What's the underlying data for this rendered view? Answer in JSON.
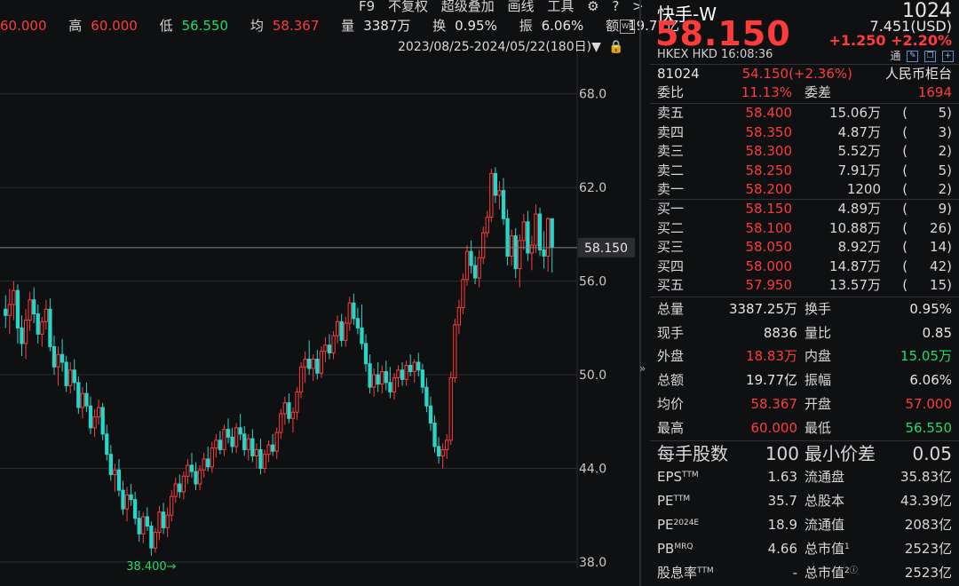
{
  "stats": {
    "open_value": "60.000",
    "high_label": "高",
    "high_value": "60.000",
    "low_label": "低",
    "low_value": "56.550",
    "avg_label": "均",
    "avg_value": "58.367",
    "vol_label": "量",
    "vol_value": "3387万",
    "turn_label": "换",
    "turn_value": "0.95%",
    "amp_label": "振",
    "amp_value": "6.06%",
    "amt_label": "额",
    "amt_value": "19.77亿"
  },
  "menu": {
    "f9": "F9",
    "adjust": "不复权",
    "overlay": "超级叠加",
    "draw": "画线",
    "tools": "工具",
    "gear_icon": "gear-icon",
    "help_icon": "help-icon",
    "more_icon": "chevron-right-icon"
  },
  "date_range": "2023/08/25-2024/05/22(180日)",
  "chart_data": {
    "type": "candlestick",
    "y_ticks": [
      "68.0",
      "62.0",
      "56.0",
      "50.0",
      "44.0",
      "38.0"
    ],
    "ylim": [
      37.6,
      70.6
    ],
    "last_price_tag": "58.150",
    "low_marker": "38.400→",
    "colors": {
      "up": "#ff3b3b",
      "down": "#27d6c9",
      "grid": "#2a2c31",
      "price_line": "#888888"
    },
    "candles": [
      {
        "o": 54.2,
        "h": 55.1,
        "l": 53.0,
        "c": 53.8
      },
      {
        "o": 53.8,
        "h": 55.5,
        "l": 52.6,
        "c": 54.5
      },
      {
        "o": 54.5,
        "h": 56.0,
        "l": 53.5,
        "c": 55.4
      },
      {
        "o": 55.4,
        "h": 55.8,
        "l": 52.0,
        "c": 53.0
      },
      {
        "o": 53.0,
        "h": 53.8,
        "l": 51.2,
        "c": 52.0
      },
      {
        "o": 52.0,
        "h": 54.2,
        "l": 51.0,
        "c": 53.5
      },
      {
        "o": 53.5,
        "h": 55.3,
        "l": 52.8,
        "c": 54.8
      },
      {
        "o": 54.8,
        "h": 55.6,
        "l": 53.3,
        "c": 53.9
      },
      {
        "o": 53.9,
        "h": 54.5,
        "l": 52.0,
        "c": 52.6
      },
      {
        "o": 52.6,
        "h": 53.7,
        "l": 51.8,
        "c": 53.4
      },
      {
        "o": 53.4,
        "h": 54.8,
        "l": 52.9,
        "c": 54.2
      },
      {
        "o": 54.2,
        "h": 54.9,
        "l": 51.5,
        "c": 51.8
      },
      {
        "o": 51.8,
        "h": 52.5,
        "l": 50.0,
        "c": 50.5
      },
      {
        "o": 50.5,
        "h": 51.8,
        "l": 49.3,
        "c": 51.3
      },
      {
        "o": 51.3,
        "h": 52.3,
        "l": 50.2,
        "c": 50.8
      },
      {
        "o": 50.8,
        "h": 51.2,
        "l": 48.9,
        "c": 49.3
      },
      {
        "o": 49.3,
        "h": 50.8,
        "l": 48.8,
        "c": 50.3
      },
      {
        "o": 50.3,
        "h": 51.0,
        "l": 49.0,
        "c": 49.5
      },
      {
        "o": 49.5,
        "h": 49.9,
        "l": 47.5,
        "c": 47.9
      },
      {
        "o": 47.9,
        "h": 49.2,
        "l": 47.2,
        "c": 48.8
      },
      {
        "o": 48.8,
        "h": 49.5,
        "l": 47.6,
        "c": 48.0
      },
      {
        "o": 48.0,
        "h": 48.6,
        "l": 46.2,
        "c": 46.6
      },
      {
        "o": 46.6,
        "h": 47.8,
        "l": 46.0,
        "c": 47.3
      },
      {
        "o": 47.3,
        "h": 48.4,
        "l": 46.8,
        "c": 47.9
      },
      {
        "o": 47.9,
        "h": 48.2,
        "l": 45.8,
        "c": 46.2
      },
      {
        "o": 46.2,
        "h": 46.8,
        "l": 44.5,
        "c": 44.9
      },
      {
        "o": 44.9,
        "h": 45.5,
        "l": 43.2,
        "c": 43.6
      },
      {
        "o": 43.6,
        "h": 44.3,
        "l": 42.5,
        "c": 43.9
      },
      {
        "o": 43.9,
        "h": 44.6,
        "l": 42.2,
        "c": 42.6
      },
      {
        "o": 42.6,
        "h": 43.2,
        "l": 41.0,
        "c": 41.4
      },
      {
        "o": 41.4,
        "h": 42.8,
        "l": 40.6,
        "c": 42.3
      },
      {
        "o": 42.3,
        "h": 43.0,
        "l": 41.6,
        "c": 42.0
      },
      {
        "o": 42.0,
        "h": 42.5,
        "l": 40.4,
        "c": 40.8
      },
      {
        "o": 40.8,
        "h": 41.3,
        "l": 39.3,
        "c": 39.8
      },
      {
        "o": 39.8,
        "h": 41.2,
        "l": 39.2,
        "c": 40.9
      },
      {
        "o": 40.9,
        "h": 41.5,
        "l": 40.0,
        "c": 40.3
      },
      {
        "o": 40.3,
        "h": 40.6,
        "l": 38.4,
        "c": 38.9
      },
      {
        "o": 38.9,
        "h": 40.2,
        "l": 38.6,
        "c": 39.9
      },
      {
        "o": 39.9,
        "h": 41.6,
        "l": 39.4,
        "c": 41.2
      },
      {
        "o": 41.2,
        "h": 41.8,
        "l": 39.8,
        "c": 40.2
      },
      {
        "o": 40.2,
        "h": 41.5,
        "l": 39.6,
        "c": 41.0
      },
      {
        "o": 41.0,
        "h": 42.6,
        "l": 40.6,
        "c": 42.2
      },
      {
        "o": 42.2,
        "h": 43.4,
        "l": 41.8,
        "c": 43.0
      },
      {
        "o": 43.0,
        "h": 43.6,
        "l": 42.1,
        "c": 42.5
      },
      {
        "o": 42.5,
        "h": 43.8,
        "l": 42.0,
        "c": 43.5
      },
      {
        "o": 43.5,
        "h": 44.6,
        "l": 43.0,
        "c": 44.2
      },
      {
        "o": 44.2,
        "h": 45.0,
        "l": 43.4,
        "c": 43.8
      },
      {
        "o": 43.8,
        "h": 44.4,
        "l": 42.6,
        "c": 43.0
      },
      {
        "o": 43.0,
        "h": 44.2,
        "l": 42.6,
        "c": 43.9
      },
      {
        "o": 43.9,
        "h": 45.0,
        "l": 43.4,
        "c": 44.6
      },
      {
        "o": 44.6,
        "h": 45.4,
        "l": 43.8,
        "c": 44.1
      },
      {
        "o": 44.1,
        "h": 45.7,
        "l": 43.7,
        "c": 45.3
      },
      {
        "o": 45.3,
        "h": 46.2,
        "l": 44.7,
        "c": 45.8
      },
      {
        "o": 45.8,
        "h": 46.4,
        "l": 44.9,
        "c": 45.2
      },
      {
        "o": 45.2,
        "h": 46.8,
        "l": 44.8,
        "c": 46.5
      },
      {
        "o": 46.5,
        "h": 47.2,
        "l": 45.6,
        "c": 46.0
      },
      {
        "o": 46.0,
        "h": 46.6,
        "l": 45.0,
        "c": 45.4
      },
      {
        "o": 45.4,
        "h": 46.9,
        "l": 45.0,
        "c": 46.6
      },
      {
        "o": 46.6,
        "h": 47.5,
        "l": 45.8,
        "c": 46.2
      },
      {
        "o": 46.2,
        "h": 46.7,
        "l": 44.8,
        "c": 45.2
      },
      {
        "o": 45.2,
        "h": 46.2,
        "l": 44.5,
        "c": 45.9
      },
      {
        "o": 45.9,
        "h": 46.5,
        "l": 44.4,
        "c": 44.8
      },
      {
        "o": 44.8,
        "h": 45.6,
        "l": 44.0,
        "c": 45.2
      },
      {
        "o": 45.2,
        "h": 45.9,
        "l": 43.6,
        "c": 44.0
      },
      {
        "o": 44.0,
        "h": 45.2,
        "l": 43.7,
        "c": 44.9
      },
      {
        "o": 44.9,
        "h": 45.8,
        "l": 44.4,
        "c": 45.5
      },
      {
        "o": 45.5,
        "h": 46.2,
        "l": 44.8,
        "c": 45.1
      },
      {
        "o": 45.1,
        "h": 46.6,
        "l": 44.6,
        "c": 46.3
      },
      {
        "o": 46.3,
        "h": 47.8,
        "l": 45.9,
        "c": 47.5
      },
      {
        "o": 47.5,
        "h": 48.6,
        "l": 46.8,
        "c": 48.2
      },
      {
        "o": 48.2,
        "h": 48.8,
        "l": 46.9,
        "c": 47.2
      },
      {
        "o": 47.2,
        "h": 47.9,
        "l": 46.3,
        "c": 47.6
      },
      {
        "o": 47.6,
        "h": 49.2,
        "l": 47.1,
        "c": 48.9
      },
      {
        "o": 48.9,
        "h": 50.8,
        "l": 48.5,
        "c": 50.5
      },
      {
        "o": 50.5,
        "h": 51.5,
        "l": 49.5,
        "c": 51.0
      },
      {
        "o": 51.0,
        "h": 52.2,
        "l": 50.0,
        "c": 50.4
      },
      {
        "o": 50.4,
        "h": 51.3,
        "l": 49.6,
        "c": 51.0
      },
      {
        "o": 51.0,
        "h": 51.6,
        "l": 49.7,
        "c": 50.1
      },
      {
        "o": 50.1,
        "h": 51.8,
        "l": 49.8,
        "c": 51.5
      },
      {
        "o": 51.5,
        "h": 52.4,
        "l": 50.8,
        "c": 51.9
      },
      {
        "o": 51.9,
        "h": 52.6,
        "l": 51.0,
        "c": 51.4
      },
      {
        "o": 51.4,
        "h": 52.8,
        "l": 51.0,
        "c": 52.5
      },
      {
        "o": 52.5,
        "h": 53.8,
        "l": 52.0,
        "c": 53.4
      },
      {
        "o": 53.4,
        "h": 53.9,
        "l": 51.8,
        "c": 52.2
      },
      {
        "o": 52.2,
        "h": 53.7,
        "l": 51.8,
        "c": 53.3
      },
      {
        "o": 53.3,
        "h": 55.0,
        "l": 52.8,
        "c": 54.6
      },
      {
        "o": 54.6,
        "h": 55.2,
        "l": 53.2,
        "c": 53.6
      },
      {
        "o": 53.6,
        "h": 54.3,
        "l": 52.6,
        "c": 53.0
      },
      {
        "o": 53.0,
        "h": 54.5,
        "l": 51.6,
        "c": 52.0
      },
      {
        "o": 52.0,
        "h": 52.6,
        "l": 50.2,
        "c": 50.7
      },
      {
        "o": 50.7,
        "h": 51.3,
        "l": 48.8,
        "c": 49.2
      },
      {
        "o": 49.2,
        "h": 50.4,
        "l": 48.6,
        "c": 50.0
      },
      {
        "o": 50.0,
        "h": 50.8,
        "l": 48.9,
        "c": 49.4
      },
      {
        "o": 49.4,
        "h": 50.6,
        "l": 48.8,
        "c": 50.2
      },
      {
        "o": 50.2,
        "h": 50.9,
        "l": 49.0,
        "c": 49.5
      },
      {
        "o": 49.5,
        "h": 50.5,
        "l": 48.5,
        "c": 48.9
      },
      {
        "o": 48.9,
        "h": 50.1,
        "l": 48.4,
        "c": 49.8
      },
      {
        "o": 49.8,
        "h": 50.6,
        "l": 49.2,
        "c": 50.3
      },
      {
        "o": 50.3,
        "h": 50.8,
        "l": 49.3,
        "c": 49.7
      },
      {
        "o": 49.7,
        "h": 50.9,
        "l": 49.3,
        "c": 50.6
      },
      {
        "o": 50.6,
        "h": 51.3,
        "l": 49.9,
        "c": 50.2
      },
      {
        "o": 50.2,
        "h": 51.0,
        "l": 49.5,
        "c": 50.8
      },
      {
        "o": 50.8,
        "h": 51.4,
        "l": 49.9,
        "c": 50.3
      },
      {
        "o": 50.3,
        "h": 50.7,
        "l": 48.8,
        "c": 49.2
      },
      {
        "o": 49.2,
        "h": 49.8,
        "l": 47.6,
        "c": 48.0
      },
      {
        "o": 48.0,
        "h": 48.6,
        "l": 46.4,
        "c": 46.9
      },
      {
        "o": 46.9,
        "h": 47.4,
        "l": 45.0,
        "c": 45.4
      },
      {
        "o": 45.4,
        "h": 46.0,
        "l": 44.3,
        "c": 44.8
      },
      {
        "o": 44.8,
        "h": 45.6,
        "l": 44.0,
        "c": 45.2
      },
      {
        "o": 45.2,
        "h": 46.2,
        "l": 44.6,
        "c": 45.8
      },
      {
        "o": 45.8,
        "h": 50.2,
        "l": 45.5,
        "c": 49.8
      },
      {
        "o": 49.8,
        "h": 53.6,
        "l": 49.5,
        "c": 53.2
      },
      {
        "o": 53.2,
        "h": 54.8,
        "l": 52.6,
        "c": 54.3
      },
      {
        "o": 54.3,
        "h": 56.5,
        "l": 53.9,
        "c": 56.1
      },
      {
        "o": 56.1,
        "h": 58.3,
        "l": 55.7,
        "c": 57.9
      },
      {
        "o": 57.9,
        "h": 58.6,
        "l": 56.5,
        "c": 57.0
      },
      {
        "o": 57.0,
        "h": 57.6,
        "l": 55.8,
        "c": 56.2
      },
      {
        "o": 56.2,
        "h": 58.0,
        "l": 55.6,
        "c": 57.5
      },
      {
        "o": 57.5,
        "h": 59.5,
        "l": 57.1,
        "c": 59.1
      },
      {
        "o": 59.1,
        "h": 60.5,
        "l": 58.8,
        "c": 60.1
      },
      {
        "o": 60.1,
        "h": 63.2,
        "l": 59.8,
        "c": 62.9
      },
      {
        "o": 62.9,
        "h": 63.3,
        "l": 61.0,
        "c": 61.5
      },
      {
        "o": 61.5,
        "h": 62.4,
        "l": 60.6,
        "c": 61.8
      },
      {
        "o": 61.8,
        "h": 62.6,
        "l": 59.6,
        "c": 60.0
      },
      {
        "o": 60.0,
        "h": 60.6,
        "l": 57.0,
        "c": 57.6
      },
      {
        "o": 57.6,
        "h": 59.3,
        "l": 57.0,
        "c": 58.9
      },
      {
        "o": 58.9,
        "h": 59.4,
        "l": 56.2,
        "c": 56.8
      },
      {
        "o": 56.8,
        "h": 59.0,
        "l": 55.6,
        "c": 58.6
      },
      {
        "o": 58.6,
        "h": 60.3,
        "l": 58.0,
        "c": 59.8
      },
      {
        "o": 59.8,
        "h": 60.5,
        "l": 57.3,
        "c": 57.8
      },
      {
        "o": 57.8,
        "h": 58.9,
        "l": 56.7,
        "c": 58.3
      },
      {
        "o": 58.3,
        "h": 60.9,
        "l": 57.8,
        "c": 60.3
      },
      {
        "o": 60.3,
        "h": 60.7,
        "l": 57.6,
        "c": 58.0
      },
      {
        "o": 58.0,
        "h": 59.2,
        "l": 56.8,
        "c": 57.6
      },
      {
        "o": 57.6,
        "h": 60.1,
        "l": 56.6,
        "c": 60.0
      },
      {
        "o": 60.0,
        "h": 60.0,
        "l": 56.55,
        "c": 58.15
      }
    ]
  },
  "quote": {
    "name": "快手-W",
    "code": "1024",
    "last_price": "58.150",
    "usd_price": "7.451(USD)",
    "change": "+1.250",
    "change_pct": "+2.20%",
    "market": "HKEX",
    "currency": "HKD",
    "time": "16:08:36",
    "tong_label": "通",
    "rmb_code": "81024",
    "rmb_price": "54.150(+2.36%)",
    "rmb_label": "人民币柜台",
    "weibi_label": "委比",
    "weibi_value": "11.13%",
    "weicha_label": "委差",
    "weicha_value": "1694"
  },
  "asks": [
    {
      "label": "卖五",
      "price": "58.400",
      "qty": "15.06万",
      "orders": "5"
    },
    {
      "label": "卖四",
      "price": "58.350",
      "qty": "4.87万",
      "orders": "3"
    },
    {
      "label": "卖三",
      "price": "58.300",
      "qty": "5.52万",
      "orders": "2"
    },
    {
      "label": "卖二",
      "price": "58.250",
      "qty": "7.91万",
      "orders": "5"
    },
    {
      "label": "卖一",
      "price": "58.200",
      "qty": "1200",
      "orders": "2"
    }
  ],
  "bids": [
    {
      "label": "买一",
      "price": "58.150",
      "qty": "4.89万",
      "orders": "9"
    },
    {
      "label": "买二",
      "price": "58.100",
      "qty": "10.88万",
      "orders": "26"
    },
    {
      "label": "买三",
      "price": "58.050",
      "qty": "8.92万",
      "orders": "14"
    },
    {
      "label": "买四",
      "price": "58.000",
      "qty": "14.87万",
      "orders": "42"
    },
    {
      "label": "买五",
      "price": "57.950",
      "qty": "13.57万",
      "orders": "15"
    }
  ],
  "stats_table": [
    {
      "l1": "总量",
      "v1": "3387.25万",
      "c1": "white",
      "l2": "换手",
      "v2": "0.95%",
      "c2": "white"
    },
    {
      "l1": "现手",
      "v1": "8836",
      "c1": "white",
      "l2": "量比",
      "v2": "0.85",
      "c2": "white"
    },
    {
      "l1": "外盘",
      "v1": "18.83万",
      "c1": "red",
      "l2": "内盘",
      "v2": "15.05万",
      "c2": "green"
    },
    {
      "l1": "总额",
      "v1": "19.77亿",
      "c1": "white",
      "l2": "振幅",
      "v2": "6.06%",
      "c2": "white"
    },
    {
      "l1": "均价",
      "v1": "58.367",
      "c1": "red",
      "l2": "开盘",
      "v2": "57.000",
      "c2": "red"
    },
    {
      "l1": "最高",
      "v1": "60.000",
      "c1": "red",
      "l2": "最低",
      "v2": "56.550",
      "c2": "green"
    }
  ],
  "lot": {
    "l1": "每手股数",
    "v1": "100",
    "l2": "最小价差",
    "v2": "0.05"
  },
  "fundamentals": [
    {
      "l1": "EPS",
      "s1": "TTM",
      "v1": "1.63",
      "l2": "流通盘",
      "s2": "",
      "v2": "35.83亿"
    },
    {
      "l1": "PE",
      "s1": "TTM",
      "v1": "35.7",
      "l2": "总股本",
      "s2": "",
      "v2": "43.39亿"
    },
    {
      "l1": "PE",
      "s1": "2024E",
      "v1": "18.9",
      "l2": "流通值",
      "s2": "",
      "v2": "2083亿"
    },
    {
      "l1": "PB",
      "s1": "MRQ",
      "v1": "4.66",
      "l2": "总市值",
      "s2": "1",
      "v2": "2523亿"
    },
    {
      "l1": "股息率",
      "s1": "TTM",
      "v1": "-",
      "l2": "总市值",
      "s2": "2ⓘ",
      "v2": "2523亿"
    }
  ]
}
